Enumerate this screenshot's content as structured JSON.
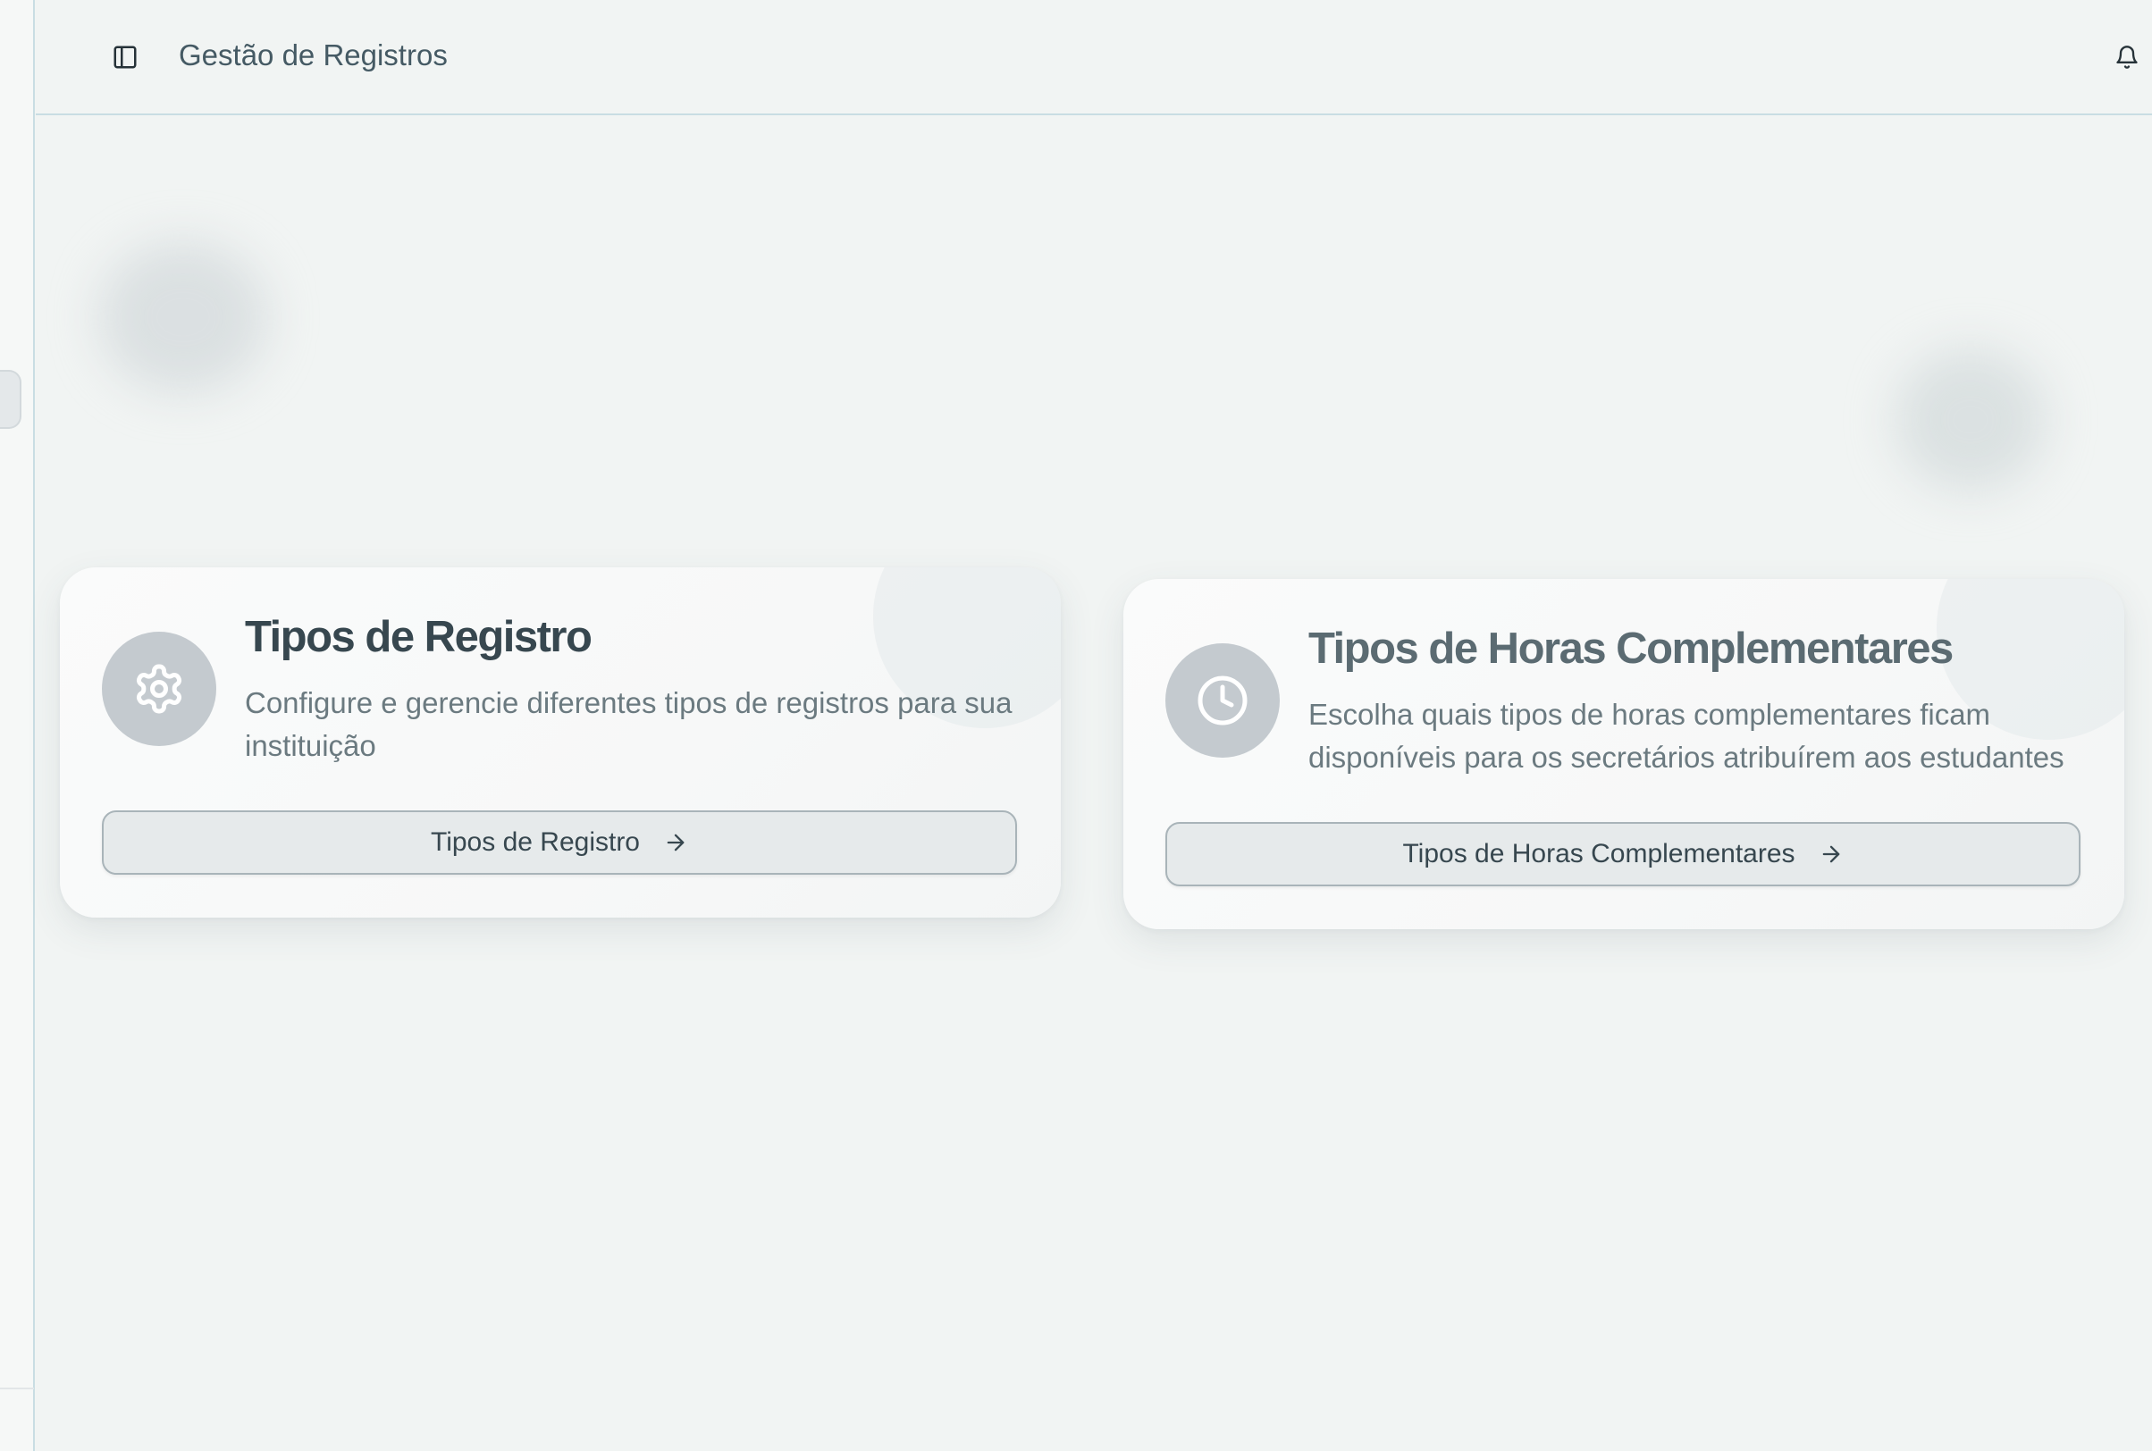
{
  "header": {
    "title": "Gestão de Registros",
    "sidebar_toggle_icon": "panel-left-icon",
    "notification_icon": "bell-icon"
  },
  "cards": [
    {
      "icon": "gear-icon",
      "title": "Tipos de Registro",
      "description": "Configure e gerencie diferentes tipos de registros para sua instituição",
      "button_label": "Tipos de Registro",
      "button_icon": "arrow-right-icon"
    },
    {
      "icon": "clock-icon",
      "title": "Tipos de Horas Complementares",
      "description": "Escolha quais tipos de horas complementares ficam disponíveis para os secretários atribuírem aos estudantes",
      "button_label": "Tipos de Horas Complementares",
      "button_icon": "arrow-right-icon"
    }
  ],
  "colors": {
    "background": "#f1f4f3",
    "text_primary": "#37474f",
    "text_secondary": "#6b7a80",
    "icon_circle": "#c4cacf",
    "border_accent": "#c9dde3"
  }
}
